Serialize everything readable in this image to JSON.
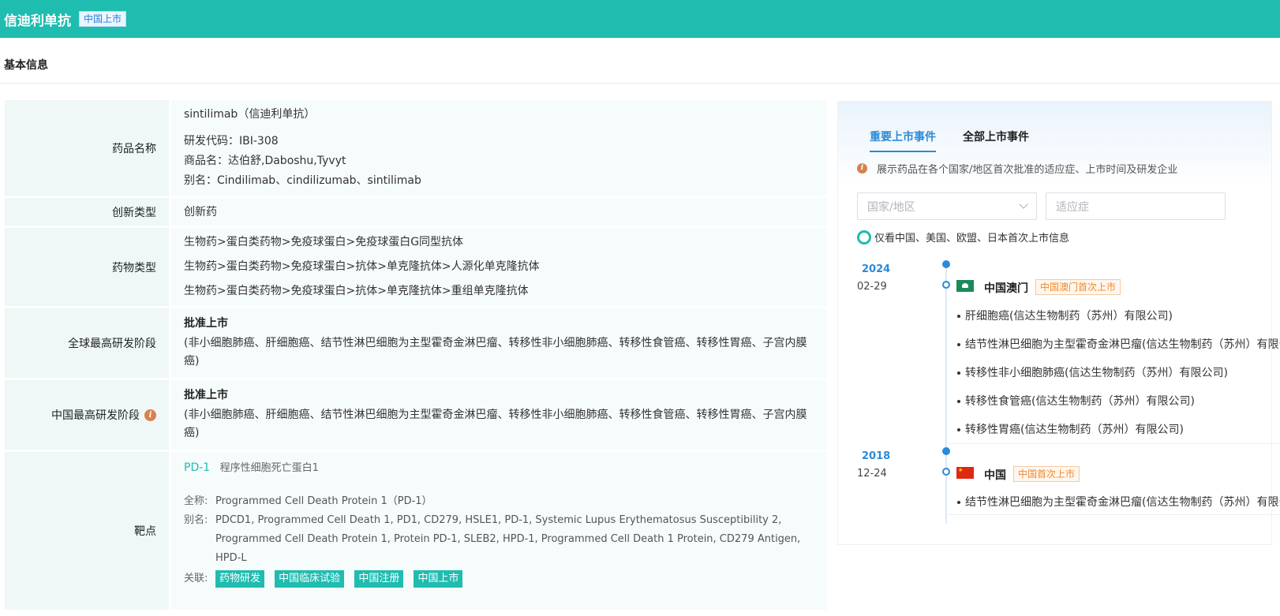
{
  "header": {
    "title": "信迪利单抗",
    "badge": "中国上市"
  },
  "section": {
    "title": "基本信息"
  },
  "info": {
    "drug_name": {
      "label": "药品名称",
      "name": "sintilimab（信迪利单抗）",
      "code": "研发代码：IBI-308",
      "trade": "商品名：达伯舒,Daboshu,Tyvyt",
      "alias": "别名：Cindilimab、cindilizumab、sintilimab"
    },
    "innovation": {
      "label": "创新类型",
      "value": "创新药"
    },
    "drug_type": {
      "label": "药物类型",
      "items": [
        "生物药>蛋白类药物>免疫球蛋白>免疫球蛋白G同型抗体",
        "生物药>蛋白类药物>免疫球蛋白>抗体>单克隆抗体>人源化单克隆抗体",
        "生物药>蛋白类药物>免疫球蛋白>抗体>单克隆抗体>重组单克隆抗体"
      ]
    },
    "global_stage": {
      "label": "全球最高研发阶段",
      "status": "批准上市",
      "detail": "(非小细胞肺癌、肝细胞癌、结节性淋巴细胞为主型霍奇金淋巴瘤、转移性非小细胞肺癌、转移性食管癌、转移性胃癌、子宫内膜癌)"
    },
    "china_stage": {
      "label": "中国最高研发阶段",
      "status": "批准上市",
      "detail": "(非小细胞肺癌、肝细胞癌、结节性淋巴细胞为主型霍奇金淋巴瘤、转移性非小细胞肺癌、转移性食管癌、转移性胃癌、子宫内膜癌)"
    },
    "target": {
      "label": "靶点",
      "code": "PD-1",
      "name": "程序性细胞死亡蛋白1",
      "full_key": "全称:",
      "full_value": "Programmed Cell Death Protein 1（PD-1）",
      "alias_key": "别名:",
      "alias_value": "PDCD1, Programmed Cell Death 1, PD1, CD279, HSLE1, PD-1, Systemic Lupus Erythematosus Susceptibility 2, Programmed Cell Death Protein 1, Protein PD-1, SLEB2, HPD-1, Programmed Cell Death 1 Protein, CD279 Antigen, HPD-L",
      "related_key": "关联:",
      "tags": [
        "药物研发",
        "中国临床试验",
        "中国注册",
        "中国上市"
      ]
    }
  },
  "panel": {
    "tabs": [
      "重要上市事件",
      "全部上市事件"
    ],
    "hint": "展示药品在各个国家/地区首次批准的适应症、上市时间及研发企业",
    "country_placeholder": "国家/地区",
    "indication_placeholder": "适应症",
    "toggle_label": "仅看中国、美国、欧盟、日本首次上市信息",
    "events": [
      {
        "year": "2024",
        "date": "02-29",
        "country": "中国澳门",
        "tag": "中国澳门首次上市",
        "indications": [
          "肝细胞癌(信达生物制药（苏州）有限公司)",
          "结节性淋巴细胞为主型霍奇金淋巴瘤(信达生物制药（苏州）有限公司)",
          "转移性非小细胞肺癌(信达生物制药（苏州）有限公司)",
          "转移性食管癌(信达生物制药（苏州）有限公司)",
          "转移性胃癌(信达生物制药（苏州）有限公司)"
        ]
      },
      {
        "year": "2018",
        "date": "12-24",
        "country": "中国",
        "tag": "中国首次上市",
        "indications": [
          "结节性淋巴细胞为主型霍奇金淋巴瘤(信达生物制药（苏州）有限公司)"
        ]
      }
    ]
  }
}
